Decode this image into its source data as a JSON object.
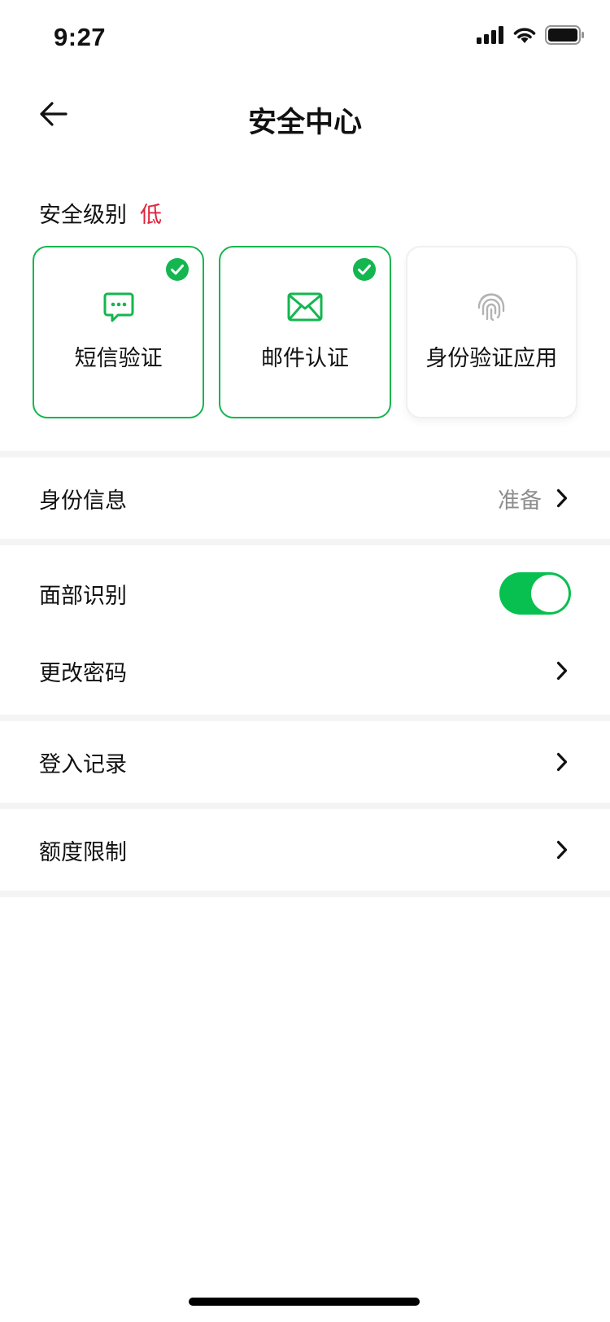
{
  "status_bar": {
    "time": "9:27",
    "icons": [
      "signal-icon",
      "wifi-icon",
      "battery-icon"
    ]
  },
  "header": {
    "title": "安全中心",
    "back_icon": "back-arrow-icon"
  },
  "security_level": {
    "label": "安全级别",
    "value": "低",
    "value_color": "#e0243b"
  },
  "verification_cards": [
    {
      "label": "短信验证",
      "icon": "chat-bubble-icon",
      "enabled": true
    },
    {
      "label": "邮件认证",
      "icon": "envelope-icon",
      "enabled": true
    },
    {
      "label": "身份验证应用",
      "icon": "fingerprint-icon",
      "enabled": false
    }
  ],
  "sections": {
    "identity": {
      "label": "身份信息",
      "value": "准备"
    },
    "face_id": {
      "label": "面部识别",
      "toggle_on": true
    },
    "change_password": {
      "label": "更改密码"
    },
    "login_records": {
      "label": "登入记录"
    },
    "limits": {
      "label": "额度限制"
    }
  },
  "colors": {
    "accent": "#14b64f",
    "toggle_on": "#08c04f",
    "warning": "#e0243b",
    "separator": "#f4f4f5"
  }
}
